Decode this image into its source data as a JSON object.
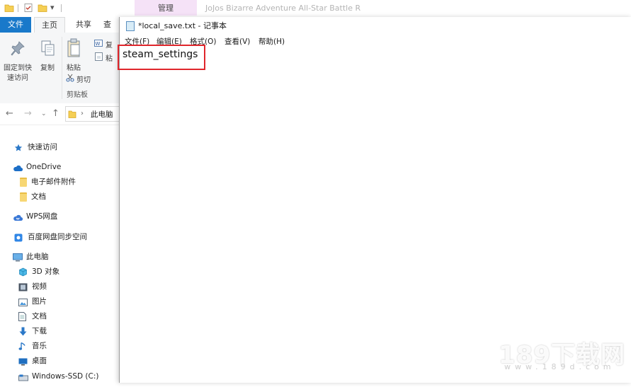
{
  "explorer": {
    "manage_tab": "管理",
    "window_title": "JoJos Bizarre Adventure All-Star Battle R",
    "ribbon_tabs": {
      "file": "文件",
      "home": "主页",
      "share": "共享",
      "view": "查"
    },
    "ribbon": {
      "pin_label_1": "固定到快",
      "pin_label_2": "速访问",
      "copy": "复制",
      "paste": "粘贴",
      "copy_path": "复",
      "paste_shortcut": "粘",
      "cut": "剪切",
      "group_clipboard": "剪贴板"
    },
    "address": {
      "location": "此电脑"
    },
    "nav_tree": [
      {
        "label": "快速访问",
        "icon": "star-icon"
      },
      {
        "label": "OneDrive",
        "icon": "cloud-icon"
      },
      {
        "label": "电子邮件附件",
        "icon": "folder-icon"
      },
      {
        "label": "文档",
        "icon": "folder-icon"
      },
      {
        "label": "WPS网盘",
        "icon": "wps-cloud-icon"
      },
      {
        "label": "百度网盘同步空间",
        "icon": "baidu-drive-icon"
      },
      {
        "label": "此电脑",
        "icon": "computer-icon"
      },
      {
        "label": "3D 对象",
        "icon": "cube-icon"
      },
      {
        "label": "视频",
        "icon": "video-icon"
      },
      {
        "label": "图片",
        "icon": "pictures-icon"
      },
      {
        "label": "文档",
        "icon": "document-icon"
      },
      {
        "label": "下载",
        "icon": "download-icon"
      },
      {
        "label": "音乐",
        "icon": "music-icon"
      },
      {
        "label": "桌面",
        "icon": "desktop-icon"
      },
      {
        "label": "Windows-SSD (C:)",
        "icon": "drive-icon"
      }
    ]
  },
  "notepad": {
    "title": "*local_save.txt - 记事本",
    "menu": [
      "文件(F)",
      "编辑(E)",
      "格式(O)",
      "查看(V)",
      "帮助(H)"
    ],
    "content": "steam_settings",
    "highlight_color": "#e0262c"
  },
  "watermark": {
    "main": "189下载网",
    "sub": "www.189d.com"
  },
  "colors": {
    "accent": "#1979ca",
    "manage_tab_bg": "#f5e2f7"
  }
}
